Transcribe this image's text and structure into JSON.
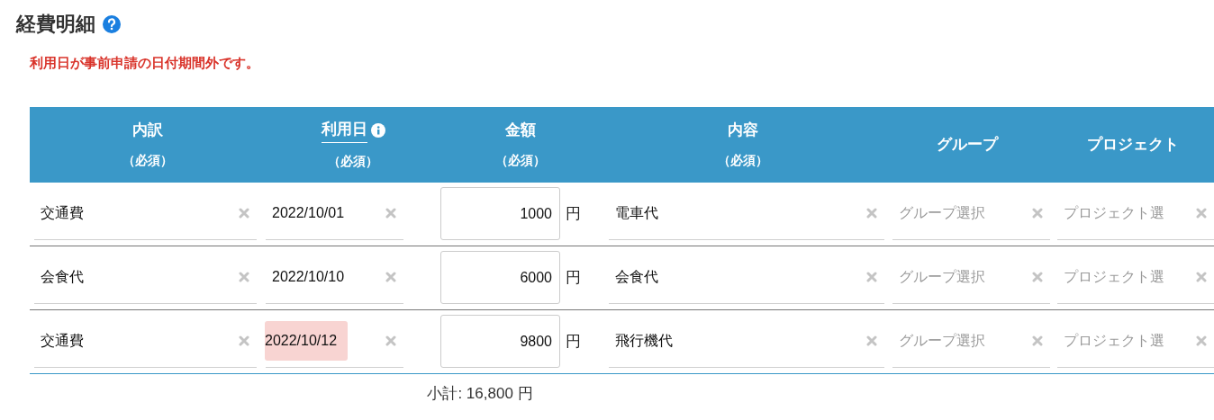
{
  "title": "経費明細",
  "error": "利用日が事前申請の日付期間外です。",
  "columns": [
    {
      "label": "内訳",
      "note": "（必須）",
      "has_info": false
    },
    {
      "label": "利用日",
      "note": "（必須）",
      "has_info": true
    },
    {
      "label": "金額",
      "note": "（必須）",
      "has_info": false
    },
    {
      "label": "内容",
      "note": "（必須）",
      "has_info": false
    },
    {
      "label": "グループ",
      "has_info": false
    },
    {
      "label": "プロジェクト",
      "has_info": false
    }
  ],
  "rows": [
    {
      "category": "交通費",
      "date": "2022/10/01",
      "date_invalid": false,
      "amount": "1000",
      "unit": "円",
      "content": "電車代",
      "group_placeholder": "グループ選択",
      "project_placeholder": "プロジェクト選"
    },
    {
      "category": "会食代",
      "date": "2022/10/10",
      "date_invalid": false,
      "amount": "6000",
      "unit": "円",
      "content": "会食代",
      "group_placeholder": "グループ選択",
      "project_placeholder": "プロジェクト選"
    },
    {
      "category": "交通費",
      "date": "2022/10/12",
      "date_invalid": true,
      "amount": "9800",
      "unit": "円",
      "content": "飛行機代",
      "group_placeholder": "グループ選択",
      "project_placeholder": "プロジェクト選"
    }
  ],
  "subtotal": "小計: 16,800 円"
}
